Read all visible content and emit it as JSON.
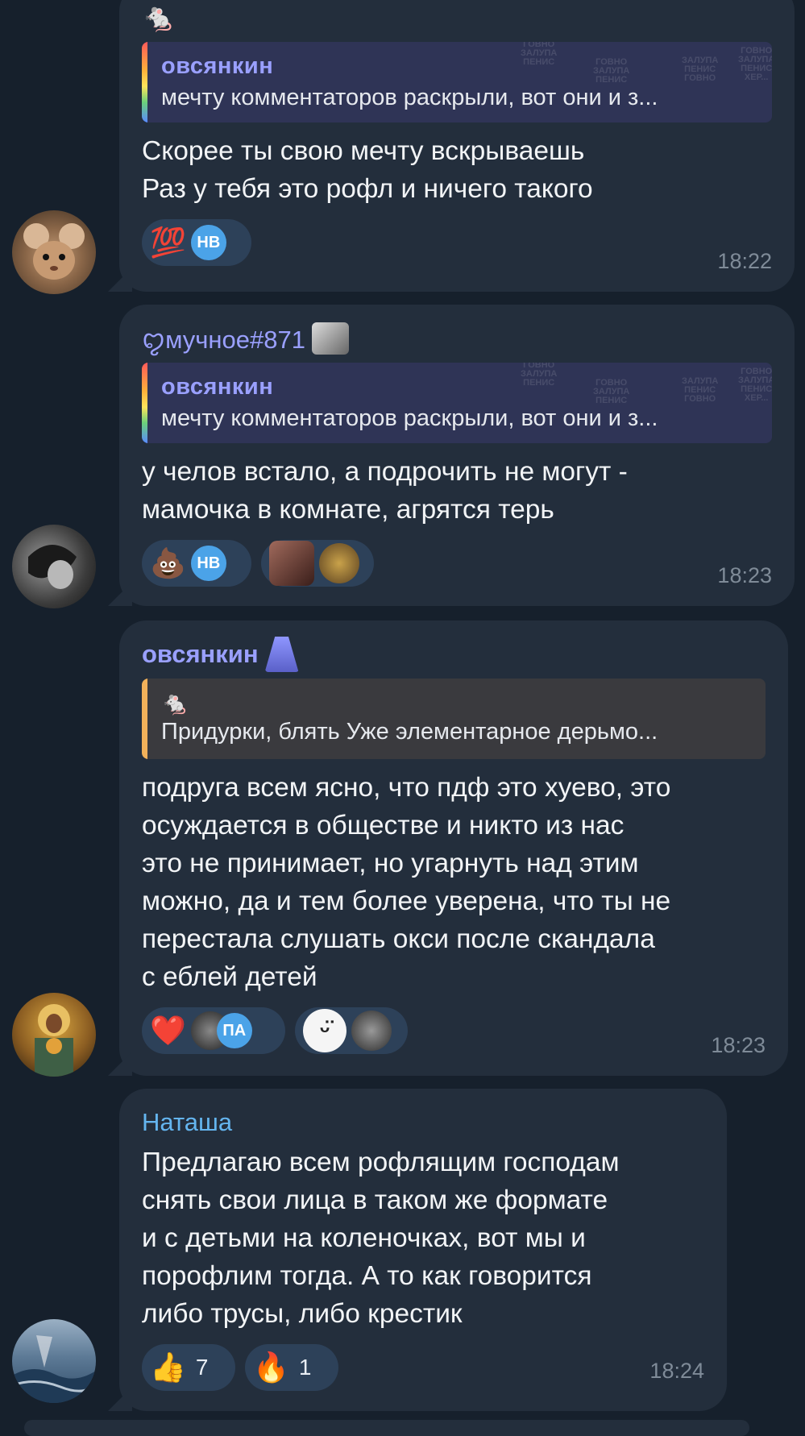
{
  "messages": [
    {
      "top_emoji": "🐁",
      "quote": {
        "name": "овсянкин",
        "text": "мечту комментаторов раскрыли, вот они и з..."
      },
      "text": "Скорее ты свою мечту вскрываешь\nРаз у тебя это рофл и ничего такого",
      "reactions": [
        {
          "emoji": "💯",
          "avatar_initials": "НВ"
        }
      ],
      "time": "18:22"
    },
    {
      "sender": "ꨄмучное#871",
      "quote": {
        "name": "овсянкин",
        "text": "мечту комментаторов раскрыли, вот они и з..."
      },
      "text": "у челов встало, а подрочить не могут -\nмамочка в комнате, агрятся терь",
      "reactions": [
        {
          "emoji": "💩",
          "avatar_initials": "НВ"
        }
      ],
      "time": "18:23"
    },
    {
      "sender": "овсянкин",
      "quote": {
        "emoji": "🐁",
        "text": "Придурки, блять Уже элементарное дерьмо..."
      },
      "text": "подруга всем ясно, что пдф это хуево, это\nосуждается в обществе и никто из нас\nэто не принимает, но угарнуть над этим\nможно, да и тем более уверена, что ты не\nперестала слушать окси после скандала\nс еблей детей",
      "reactions": [
        {
          "emoji": "❤️",
          "avatar_initials": "ПА"
        }
      ],
      "time": "18:23"
    },
    {
      "sender": "Наташа",
      "text": "Предлагаю всем рофлящим господам\nснять свои лица в таком же формате\nи с детьми на коленочках, вот мы и\nпорофлим тогда. А то как говорится\nлибо трусы, либо крестик",
      "reactions": [
        {
          "emoji": "👍",
          "count": "7"
        },
        {
          "emoji": "🔥",
          "count": "1"
        }
      ],
      "time": "18:24"
    }
  ],
  "watermark": {
    "words": [
      "ГОВНО",
      "ЗАЛУПА",
      "ПЕНИС",
      "ХЕР..."
    ]
  },
  "colors": {
    "background": "#16202c",
    "bubble": "#232e3c",
    "accent_purple": "#9aa0ff",
    "accent_blue": "#64b5ef",
    "reaction_pill": "#2d4159"
  }
}
